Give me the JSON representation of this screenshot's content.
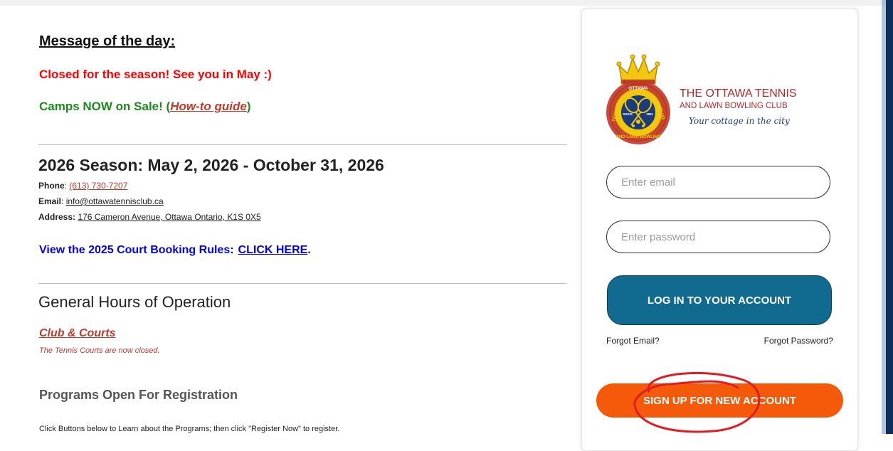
{
  "main": {
    "motd_title": "Message of the day:",
    "closed_msg": "Closed for the season! See you in May :)",
    "camps_prefix": "Camps NOW on Sale! (",
    "camps_link": "How-to guide",
    "camps_suffix": ")",
    "season": "2026 Season: May 2, 2026 - October 31, 2026",
    "phone_label": "Phone",
    "phone_value": "(613) 730-7207",
    "email_label": "Email",
    "email_value": "info@ottawatennisclub.ca",
    "address_label": "Address:",
    "address_value": "176 Cameron Avenue, Ottawa Ontario, K1S 0X5",
    "rules_text": "View the 2025 Court Booking Rules:",
    "rules_cta": "CLICK HERE",
    "rules_period": ".",
    "hours_title": "General Hours of Operation",
    "club_courts": "Club & Courts",
    "courts_closed": "The Tennis Courts are now closed.",
    "programs_title": "Programs Open For Registration",
    "programs_instructions": "Click Buttons below to Learn about the Programs; then click \"Register Now\" to register."
  },
  "login": {
    "club_name": "THE OTTAWA TENNIS",
    "club_sub": "AND LAWN BOWLING CLUB",
    "tagline": "Your cottage in the city",
    "logo_text": {
      "top": "OTTAWA",
      "left": "TENNIS",
      "right": "CLUB",
      "bottom": "AND LAWN BOWLING",
      "since": "SINCE",
      "year": "1881"
    },
    "email_placeholder": "Enter email",
    "password_placeholder": "Enter password",
    "login_button": "LOG IN TO YOUR ACCOUNT",
    "forgot_email": "Forgot Email?",
    "forgot_password": "Forgot Password?",
    "signup_button": "SIGN UP FOR NEW ACCOUNT"
  },
  "colors": {
    "alert_red": "#ff0000",
    "camps_green": "#1a8a1a",
    "link_red": "#c0392b",
    "rules_blue": "#0000ee",
    "login_button": "#116a8f",
    "signup_button": "#f55a0a",
    "club_red": "#b22a2a",
    "tagline_navy": "#1a3c7a",
    "annotation_red": "#e11b22"
  }
}
